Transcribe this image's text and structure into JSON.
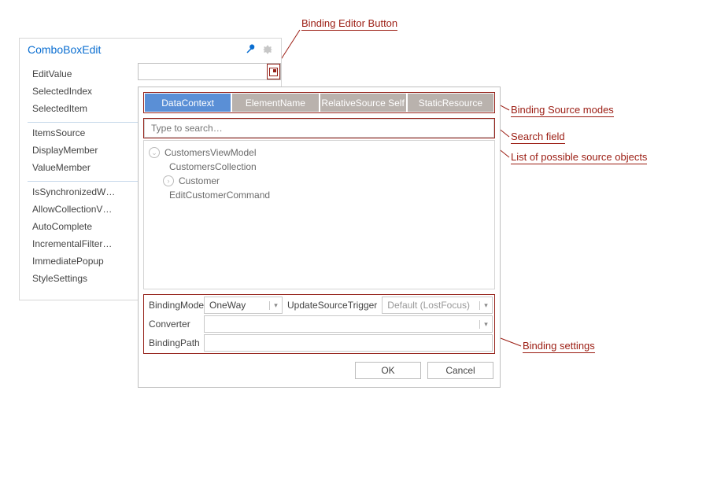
{
  "callouts": {
    "editor_button": "Binding Editor Button",
    "source_modes": "Binding Source modes",
    "search_field": "Search field",
    "source_list": "List of possible source objects",
    "settings": "Binding settings"
  },
  "panel": {
    "title": "ComboBoxEdit",
    "groups": [
      {
        "items": [
          "EditValue",
          "SelectedIndex",
          "SelectedItem"
        ]
      },
      {
        "items": [
          "ItemsSource",
          "DisplayMember",
          "ValueMember"
        ]
      },
      {
        "items": [
          "IsSynchronizedW…",
          "AllowCollectionV…",
          "AutoComplete",
          "IncrementalFilter…",
          "ImmediatePopup",
          "StyleSettings"
        ]
      }
    ]
  },
  "editor": {
    "value": ""
  },
  "popup": {
    "tabs": [
      "DataContext",
      "ElementName",
      "RelativeSource Self",
      "StaticResource"
    ],
    "active_tab": 0,
    "search_placeholder": "Type to search…",
    "tree": {
      "root": "CustomersViewModel",
      "children": [
        "CustomersCollection",
        "Customer",
        "EditCustomerCommand"
      ]
    },
    "settings": {
      "binding_mode_label": "BindingMode",
      "binding_mode_value": "OneWay",
      "ust_label": "UpdateSourceTrigger",
      "ust_value": "Default (LostFocus)",
      "converter_label": "Converter",
      "converter_value": "",
      "binding_path_label": "BindingPath",
      "binding_path_value": ""
    },
    "buttons": {
      "ok": "OK",
      "cancel": "Cancel"
    }
  }
}
